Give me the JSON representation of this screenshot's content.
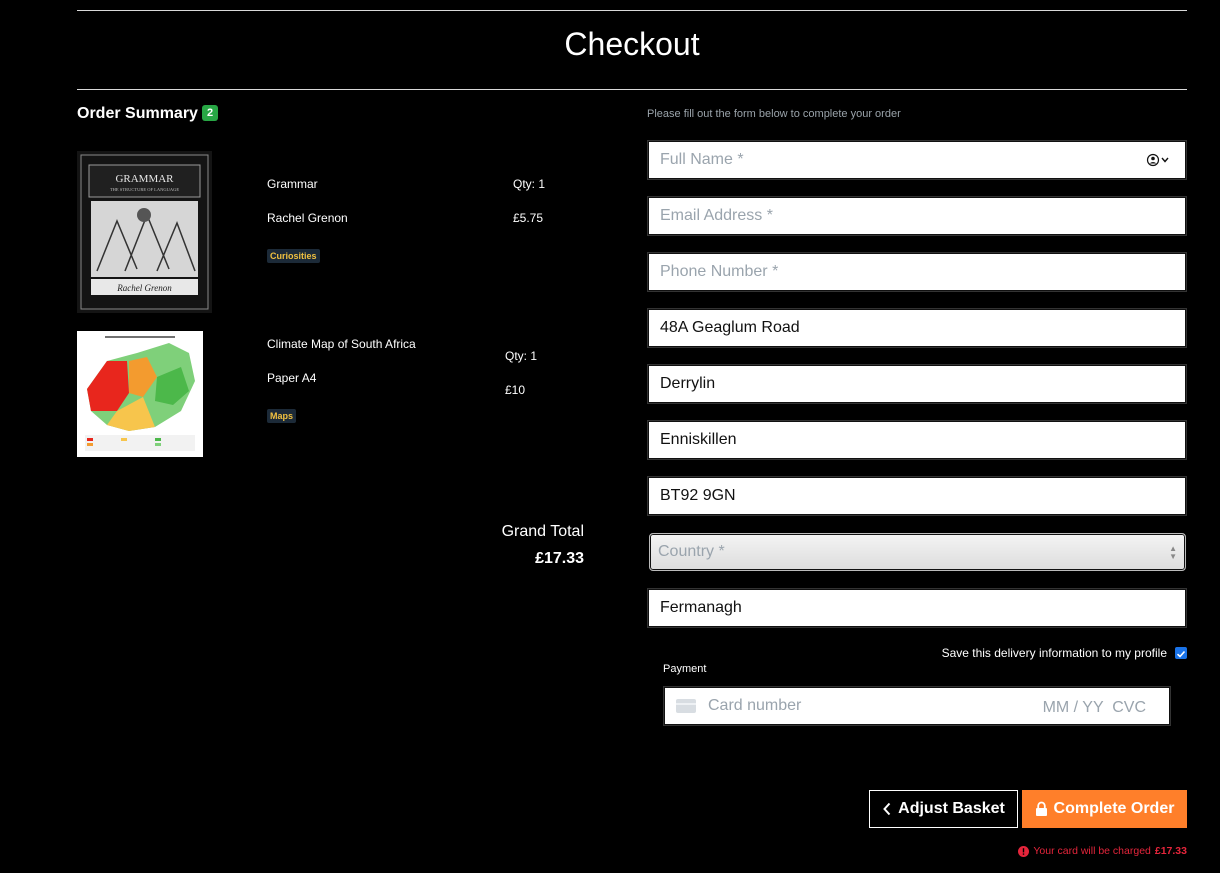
{
  "page": {
    "title": "Checkout"
  },
  "summary": {
    "heading": "Order Summary",
    "count": "2",
    "items": [
      {
        "title": "Grammar",
        "subtitle": "Rachel Grenon",
        "qty": "Qty: 1",
        "price": "£5.75",
        "tag": "Curiosities"
      },
      {
        "title": "Climate Map of South Africa",
        "subtitle": "Paper A4",
        "qty": "Qty: 1",
        "price": "£10",
        "tag": "Maps"
      }
    ],
    "grand_total_label": "Grand Total",
    "grand_total": "£17.33"
  },
  "form": {
    "intro": "Please fill out the form below to complete your order",
    "full_name_placeholder": "Full Name *",
    "email_placeholder": "Email Address *",
    "phone_placeholder": "Phone Number *",
    "street": "48A Geaglum Road",
    "town": "Derrylin",
    "city": "Enniskillen",
    "postcode": "BT92 9GN",
    "country_placeholder": "Country *",
    "county": "Fermanagh",
    "save_label": "Save this delivery information to my profile",
    "payment_label": "Payment",
    "card_placeholder": "Card number",
    "expiry_cvc_placeholder": "MM / YY  CVC"
  },
  "actions": {
    "adjust_label": "Adjust Basket",
    "complete_label": "Complete Order",
    "charge_note": "Your card will be charged",
    "charge_amount": "£17.33"
  },
  "colors": {
    "accent": "#ff7f2a",
    "badge": "#28a745",
    "warning": "#e5253b"
  }
}
